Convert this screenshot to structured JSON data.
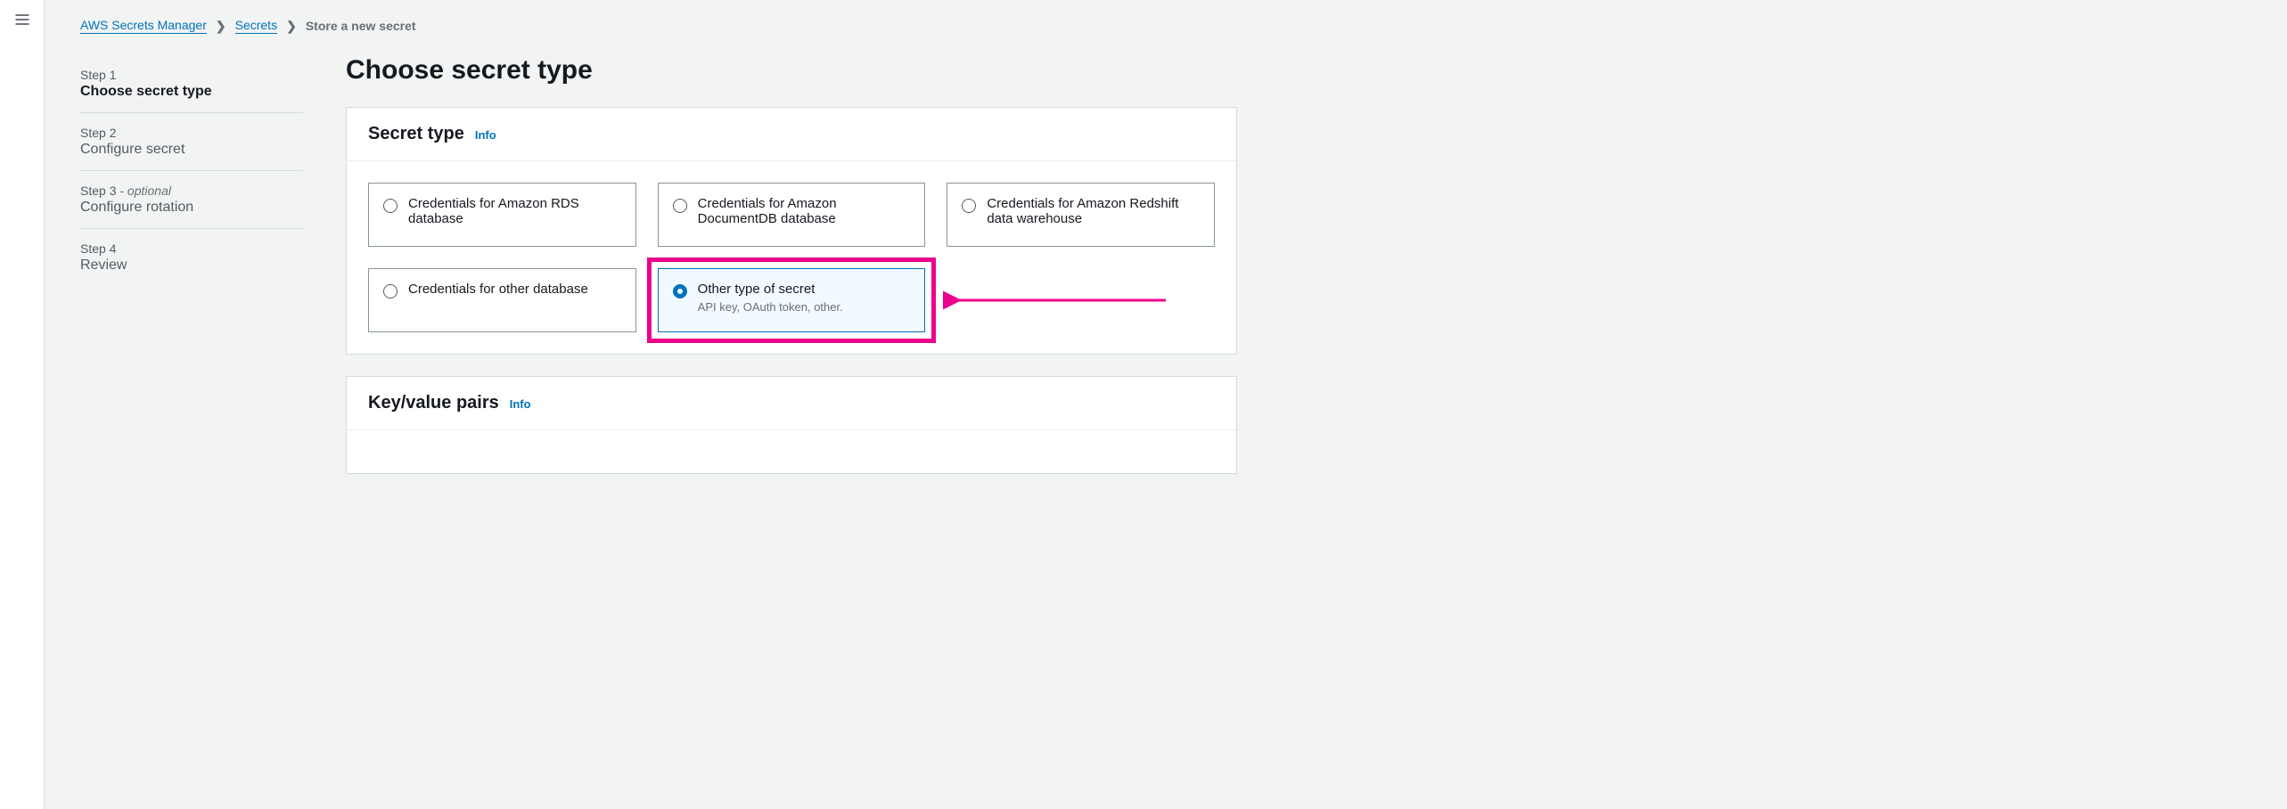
{
  "breadcrumb": {
    "root": "AWS Secrets Manager",
    "secrets": "Secrets",
    "current": "Store a new secret"
  },
  "wizard": {
    "steps": [
      {
        "num": "Step 1",
        "title": "Choose secret type",
        "optional": ""
      },
      {
        "num": "Step 2",
        "title": "Configure secret",
        "optional": ""
      },
      {
        "num": "Step 3",
        "title": "Configure rotation",
        "optional": " - optional"
      },
      {
        "num": "Step 4",
        "title": "Review",
        "optional": ""
      }
    ]
  },
  "page": {
    "title": "Choose secret type"
  },
  "info_label": "Info",
  "secret_type": {
    "heading": "Secret type",
    "tiles": [
      {
        "label": "Credentials for Amazon RDS database",
        "desc": ""
      },
      {
        "label": "Credentials for Amazon DocumentDB database",
        "desc": ""
      },
      {
        "label": "Credentials for Amazon Redshift data warehouse",
        "desc": ""
      },
      {
        "label": "Credentials for other database",
        "desc": ""
      },
      {
        "label": "Other type of secret",
        "desc": "API key, OAuth token, other."
      }
    ]
  },
  "kv": {
    "heading": "Key/value pairs"
  }
}
